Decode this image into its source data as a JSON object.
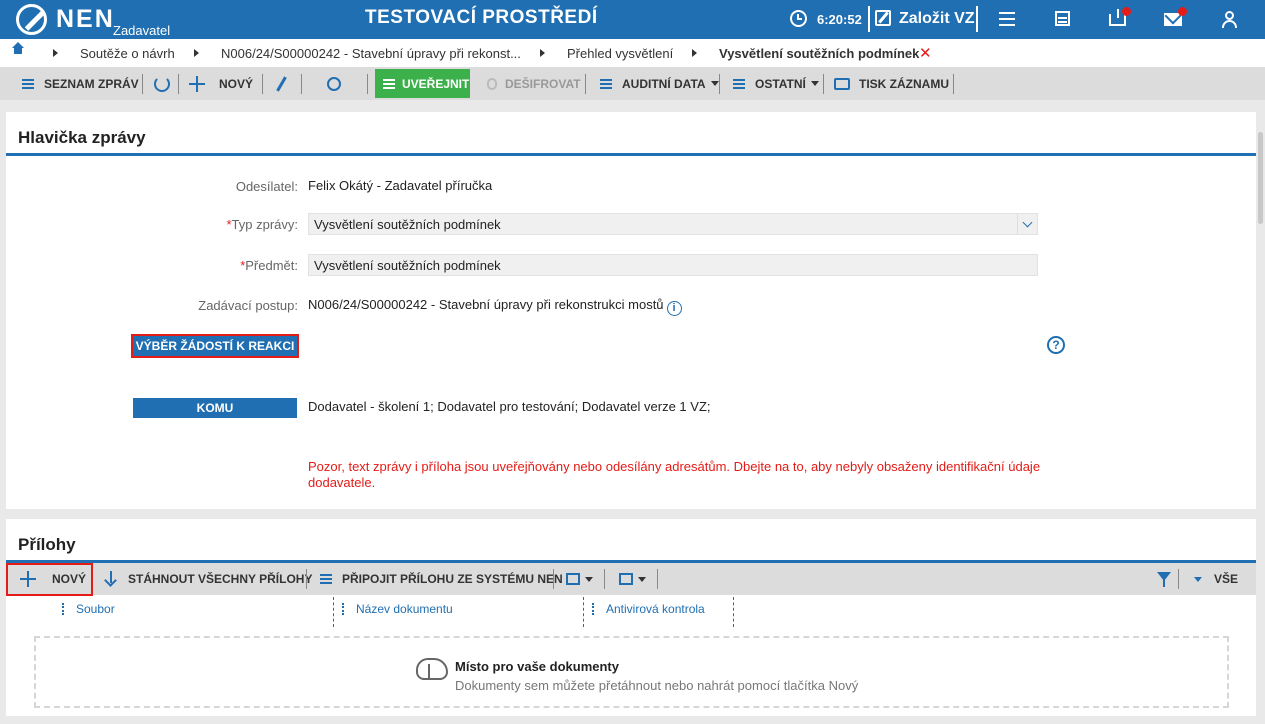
{
  "topbar": {
    "logo": "NEN",
    "role": "Zadavatel",
    "env_title": "TESTOVACÍ PROSTŘEDÍ",
    "time": "6:20:52",
    "create_label": "Založit VZ",
    "icons": [
      "menu-icon",
      "calculator-icon",
      "inbox-icon",
      "mail-icon",
      "user-icon"
    ]
  },
  "breadcrumb": {
    "items": [
      "Soutěže o návrh",
      "N006/24/S00000242 - Stavební úpravy při rekonst...",
      "Přehled vysvětlení",
      "Vysvětlení soutěžních podmínek"
    ]
  },
  "toolbar": {
    "list_label": "SEZNAM ZPRÁV",
    "new_label": "NOVÝ",
    "publish_label": "UVEŘEJNIT",
    "decrypt_label": "DEŠIFROVAT",
    "audit_label": "AUDITNÍ DATA",
    "other_label": "OSTATNÍ",
    "print_label": "TISK ZÁZNAMU"
  },
  "header": {
    "title": "Hlavička zprávy",
    "sender_label": "Odesílatel:",
    "sender_value": "Felix Okátý - Zadavatel příručka",
    "type_label": "Typ zprávy:",
    "type_value": "Vysvětlení soutěžních podmínek",
    "subject_label": "Předmět:",
    "subject_value": "Vysvětlení soutěžních podmínek",
    "procedure_label": "Zadávací postup:",
    "procedure_value": "N006/24/S00000242 - Stavební úpravy při rekonstrukci mostů",
    "select_requests_label": "VÝBĚR ŽÁDOSTÍ K REAKCI",
    "to_label": "KOMU",
    "to_value": "Dodavatel - školení 1; Dodavatel pro testování; Dodavatel verze 1 VZ;",
    "warning_line1": "Pozor, text zprávy i příloha jsou uveřejňovány nebo odesílány adresátům. Dbejte na to, aby nebyly obsaženy identifikační údaje",
    "warning_line2": "dodavatele.",
    "help": "?",
    "info": "i",
    "required": "*"
  },
  "attachments": {
    "title": "Přílohy",
    "new_label": "NOVÝ",
    "download_all_label": "STÁHNOUT VŠECHNY PŘÍLOHY",
    "attach_from_system_label": "PŘIPOJIT PŘÍLOHU ZE SYSTÉMU NEN",
    "all_label": "VŠE",
    "columns": [
      "Soubor",
      "Název dokumentu",
      "Antivirová kontrola"
    ],
    "dropzone_title": "Místo pro vaše dokumenty",
    "dropzone_sub": "Dokumenty sem můžete přetáhnout nebo nahrát pomocí tlačítka Nový"
  },
  "colors": {
    "primary": "#1f6fb2",
    "publish": "#3cb04a",
    "warning": "#e41b17"
  }
}
